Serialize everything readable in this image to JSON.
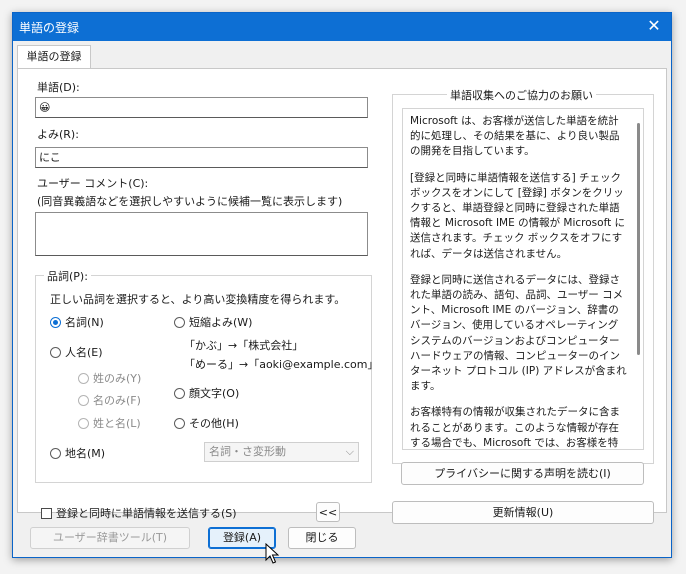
{
  "window": {
    "title": "単語の登録",
    "close_glyph": "✕"
  },
  "tab": {
    "label": "単語の登録"
  },
  "word": {
    "label": "単語(D):",
    "value": "😀"
  },
  "reading": {
    "label": "よみ(R):",
    "value": "にこ"
  },
  "comment": {
    "label": "ユーザー コメント(C):",
    "hint": "(同音異義語などを選択しやすいように候補一覧に表示します)",
    "value": ""
  },
  "pos": {
    "title": "品詞(P):",
    "description": "正しい品詞を選択すると、より高い変換精度を得られます。",
    "noun": "名詞(N)",
    "person": "人名(E)",
    "surname": "姓のみ(Y)",
    "givenname": "名のみ(F)",
    "fullname": "姓と名(L)",
    "place": "地名(M)",
    "short": "短縮よみ(W)",
    "example1": "「かぶ」→「株式会社」",
    "example2": "「めーる」→「aoki@example.com」",
    "emoticon": "顔文字(O)",
    "other": "その他(H)",
    "select_value": "名詞・さ変形動",
    "selected": "noun"
  },
  "send_check": {
    "label": "登録と同時に単語情報を送信する(S)"
  },
  "collapse_button": "<<",
  "info": {
    "title": "単語収集へのご協力のお願い",
    "paragraphs": [
      "Microsoft は、お客様が送信した単語を統計的に処理し、その結果を基に、より良い製品の開発を目指しています。",
      "[登録と同時に単語情報を送信する] チェックボックスをオンにして [登録] ボタンをクリックすると、単語登録と同時に登録された単語情報と Microsoft IME の情報が Microsoft に送信されます。チェック ボックスをオフにすれば、データは送信されません。",
      "登録と同時に送信されるデータには、登録された単語の読み、語句、品詞、ユーザー コメント、Microsoft IME のバージョン、辞書のバージョン、使用しているオペレーティング システムのバージョンおよびコンピューター ハードウェアの情報、コンピューターのインターネット プロトコル (IP) アドレスが含まれます。",
      "お客様特有の情報が収集されたデータに含まれることがあります。このような情報が存在する場合でも、Microsoft では、お客様を特定するために使用することはありません。"
    ],
    "privacy_button": "プライバシーに関する声明を読む(I)",
    "update_button": "更新情報(U)"
  },
  "footer": {
    "dictionary_tool": "ユーザー辞書ツール(T)",
    "register": "登録(A)",
    "close": "閉じる"
  },
  "colors": {
    "accent": "#0d6fd4"
  }
}
